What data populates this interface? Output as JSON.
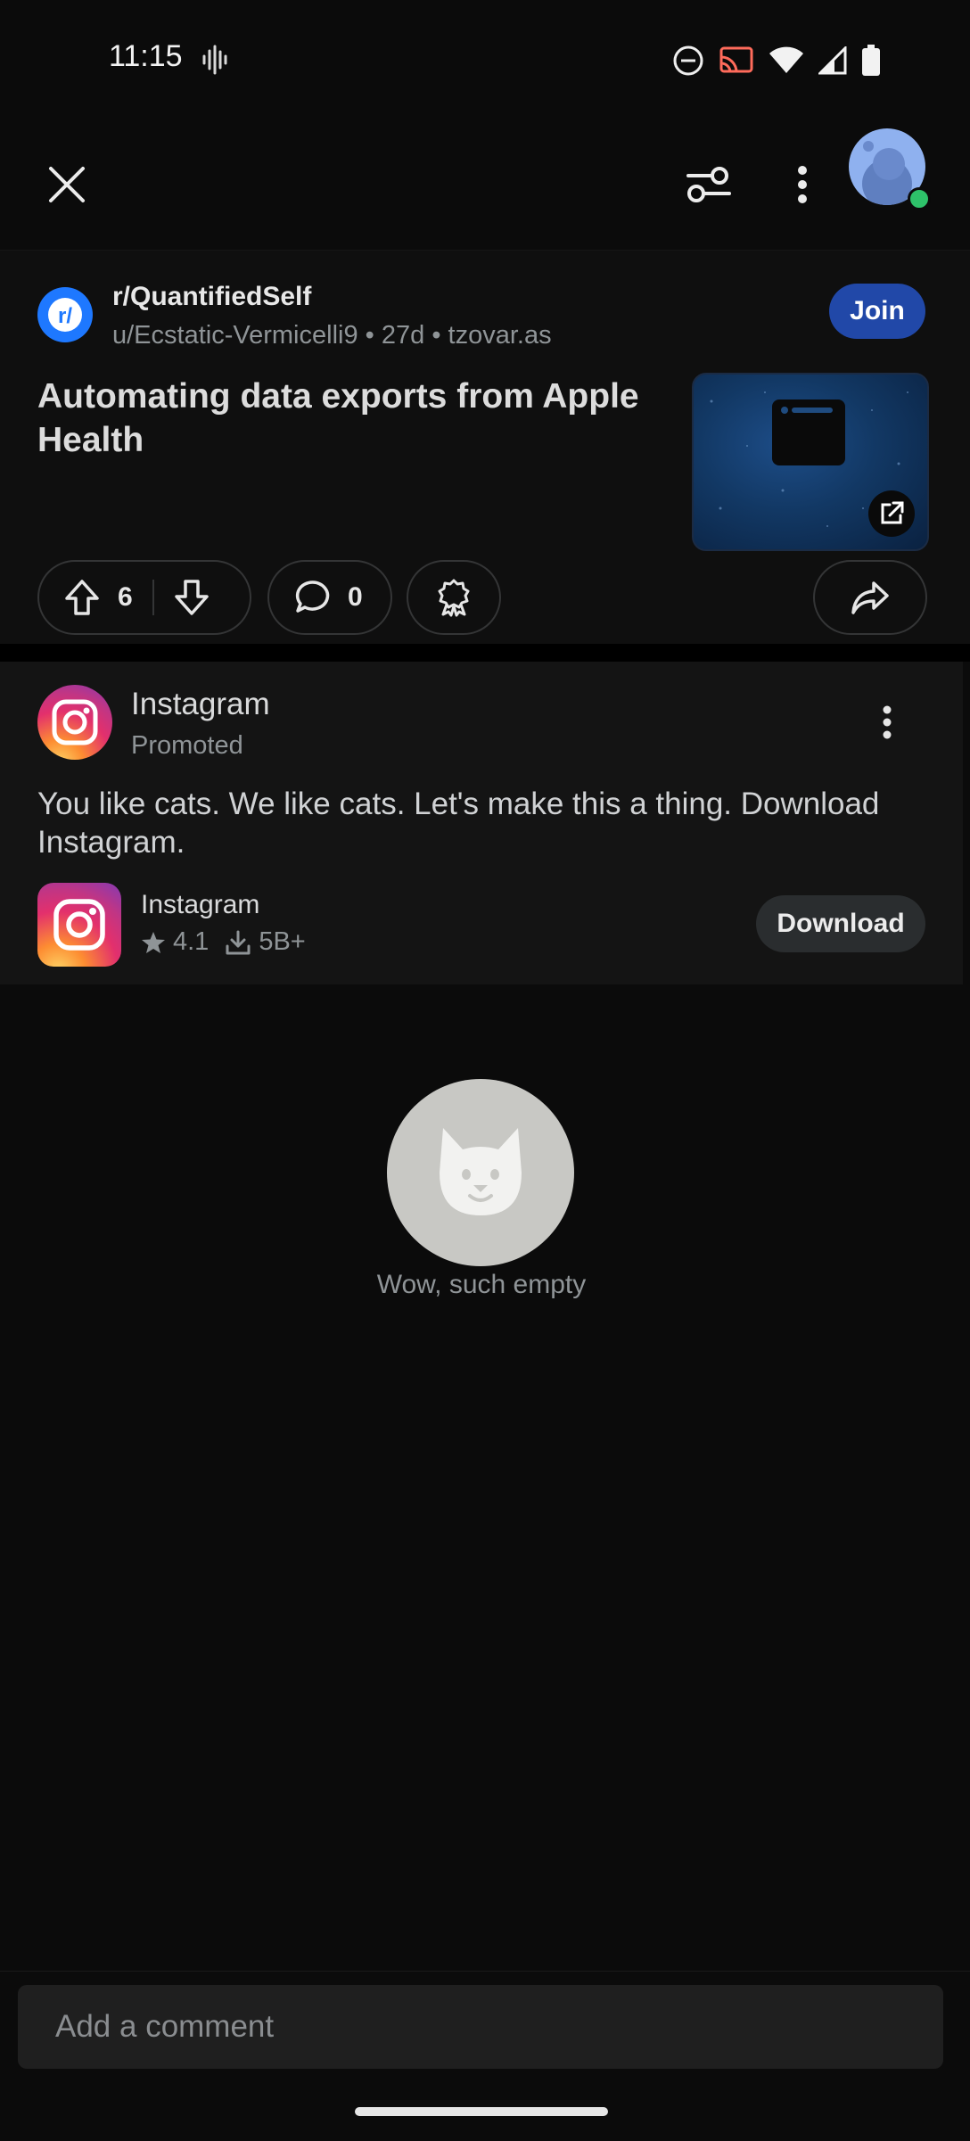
{
  "status_bar": {
    "time": "11:15",
    "icons": [
      "voice-icon",
      "dnd-icon",
      "cast-icon",
      "wifi-icon",
      "signal-icon",
      "battery-icon"
    ]
  },
  "top_bar": {
    "icons": [
      "close-icon",
      "filter-icon",
      "more-vert-icon",
      "user-avatar"
    ]
  },
  "post": {
    "subreddit": "r/QuantifiedSelf",
    "author": "u/Ecstatic-Vermicelli9",
    "age": "27d",
    "domain": "tzovar.as",
    "meta_sep": " • ",
    "join_label": "Join",
    "title": "Automating data exports from Apple Health",
    "upvotes": "6",
    "comments": "0",
    "accent": "#2148a8"
  },
  "ad": {
    "advertiser": "Instagram",
    "promoted_label": "Promoted",
    "text": "You like cats. We like cats. Let's make this a thing. Download Instagram.",
    "app_name": "Instagram",
    "rating": "4.1",
    "downloads": "5B+",
    "download_label": "Download"
  },
  "empty_state": {
    "text": "Wow, such empty"
  },
  "comment_box": {
    "placeholder": "Add a comment"
  }
}
